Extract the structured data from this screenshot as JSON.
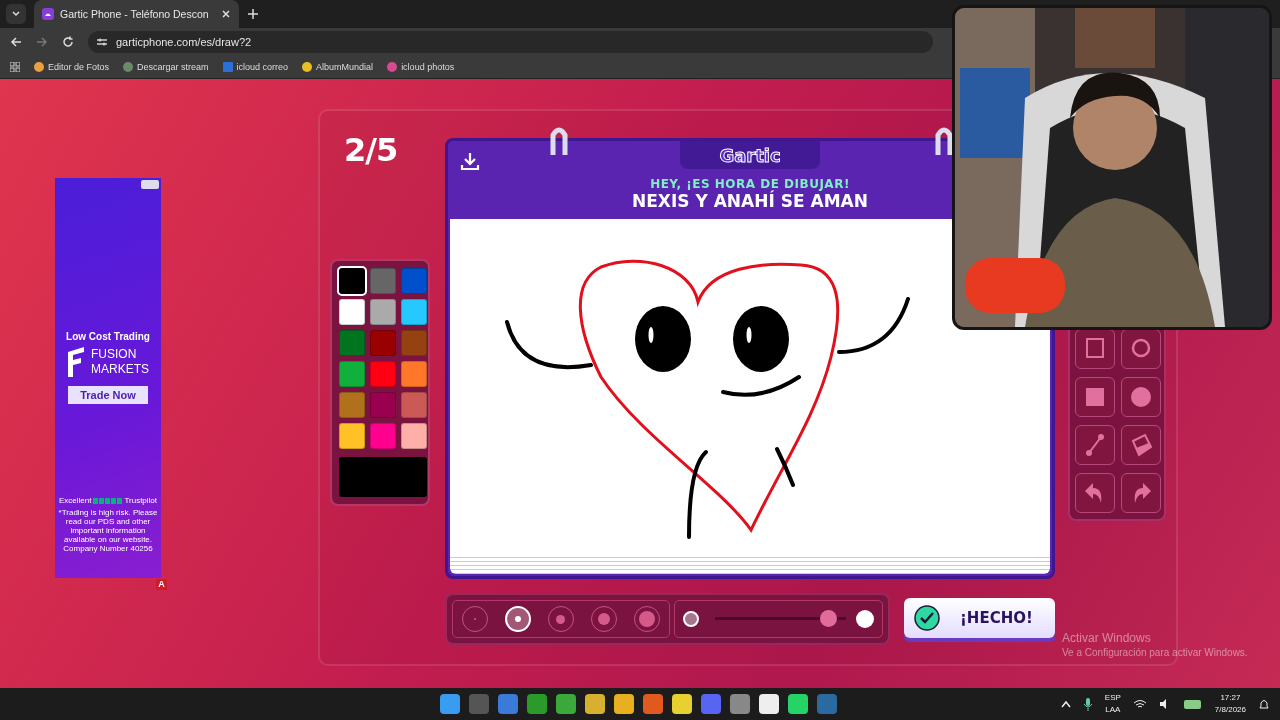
{
  "browser": {
    "tab_title": "Gartic Phone - Teléfono Descon",
    "url": "garticphone.com/es/draw?2",
    "bookmarks": [
      "Editor de Fotos",
      "Descargar stream",
      "icloud correo",
      "AlbumMundial",
      "icloud photos"
    ]
  },
  "ad": {
    "headline": "Low Cost Trading",
    "brand_lines": [
      "FUSION",
      "MARKETS"
    ],
    "button": "Trade Now",
    "rating_label": "Excellent",
    "stars": 5,
    "rating_source": "Trustpilot",
    "disclaimer": "*Trading is high risk. Please read our PDS and other important information available on our website. Company Number 40256",
    "badge": "A"
  },
  "game": {
    "round": "2/5",
    "logo": "Gartic",
    "prompt_label": "HEY, ¡ES HORA DE DIBUJAR!",
    "prompt": "NEXIS Y ANAHÍ SE AMAN",
    "palette": [
      {
        "color": "#000000",
        "selected": true
      },
      {
        "color": "#666666",
        "selected": false
      },
      {
        "color": "#0050cd",
        "selected": false
      },
      {
        "color": "#ffffff",
        "selected": false
      },
      {
        "color": "#aaaaaa",
        "selected": false
      },
      {
        "color": "#26c9ff",
        "selected": false
      },
      {
        "color": "#017420",
        "selected": false
      },
      {
        "color": "#990000",
        "selected": false
      },
      {
        "color": "#964112",
        "selected": false
      },
      {
        "color": "#11b03c",
        "selected": false
      },
      {
        "color": "#ff0013",
        "selected": false
      },
      {
        "color": "#ff7829",
        "selected": false
      },
      {
        "color": "#b0701c",
        "selected": false
      },
      {
        "color": "#99004e",
        "selected": false
      },
      {
        "color": "#cb5a57",
        "selected": false
      },
      {
        "color": "#ffc126",
        "selected": false
      },
      {
        "color": "#ff008f",
        "selected": false
      },
      {
        "color": "#feafa8",
        "selected": false
      }
    ],
    "current_color": {
      "color": "#000000"
    },
    "tools": [
      {
        "kind": "rect-outline"
      },
      {
        "kind": "ellipse-outline"
      },
      {
        "kind": "rect"
      },
      {
        "kind": "ellipse"
      },
      {
        "kind": "line"
      },
      {
        "kind": "bucket"
      },
      {
        "kind": "undo"
      },
      {
        "kind": "redo"
      }
    ],
    "brush_sizes": [
      {
        "selected": false
      },
      {
        "selected": true
      },
      {
        "selected": false
      },
      {
        "selected": false
      },
      {
        "selected": false
      }
    ],
    "opacity": {
      "level": 0.92
    },
    "done_button": "¡HECHO!"
  },
  "windows_notice": {
    "title": "Activar Windows",
    "subtitle": "Ve a Configuración para activar Windows."
  },
  "taskbar": {
    "language": [
      "ESP",
      "LAA"
    ],
    "time": "17:27",
    "date": "7/8/2026"
  }
}
